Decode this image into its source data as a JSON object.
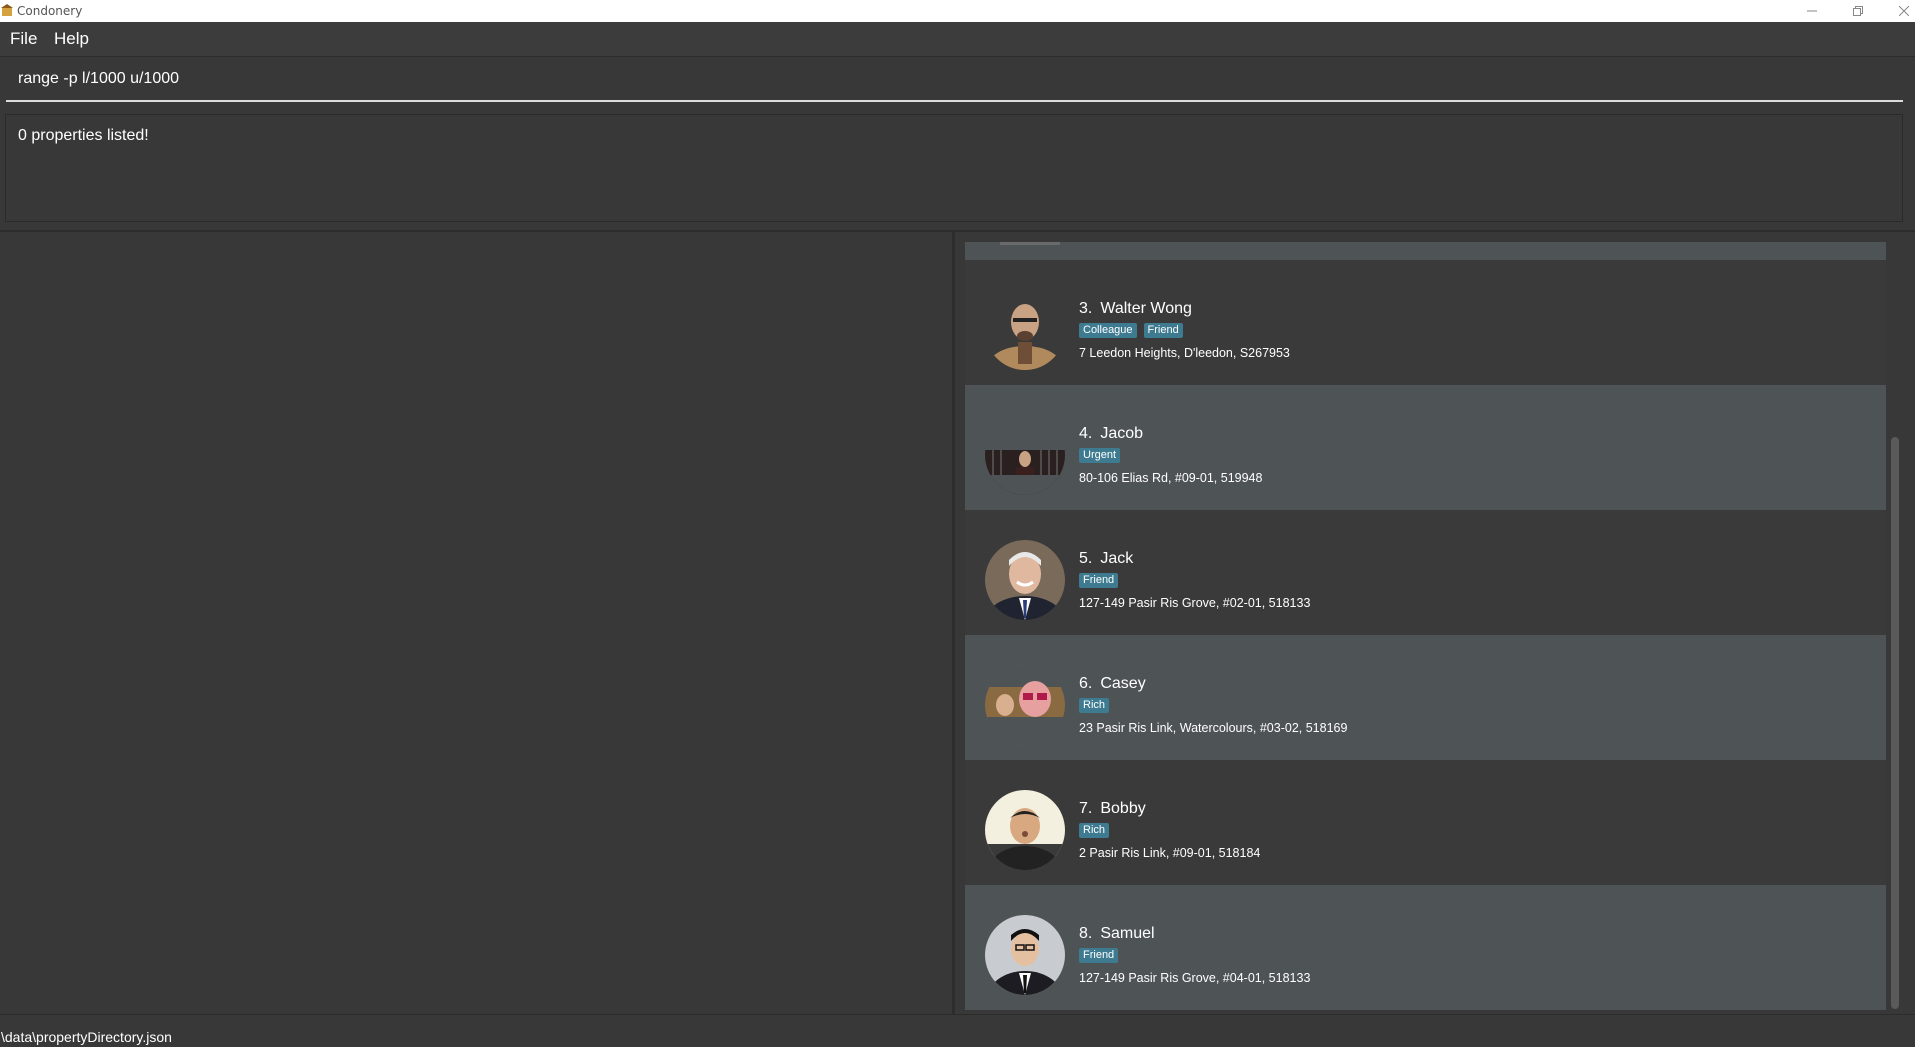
{
  "window": {
    "title": "Condonery",
    "controls": [
      "minimize-icon",
      "restore-icon",
      "close-icon"
    ]
  },
  "menu": {
    "file": "File",
    "help": "Help"
  },
  "command": {
    "value": "range -p l/1000 u/1000"
  },
  "result": {
    "message": "0 properties listed!"
  },
  "property_list": {
    "items": [
      {
        "index": "3.",
        "name": "Walter Wong",
        "tags": [
          "Colleague",
          "Friend"
        ],
        "address": "7 Leedon Heights, D'leedon, S267953"
      },
      {
        "index": "4.",
        "name": "Jacob",
        "tags": [
          "Urgent"
        ],
        "address": "80-106 Elias Rd, #09-01, 519948"
      },
      {
        "index": "5.",
        "name": "Jack",
        "tags": [
          "Friend"
        ],
        "address": "127-149 Pasir Ris Grove, #02-01, 518133"
      },
      {
        "index": "6.",
        "name": "Casey",
        "tags": [
          "Rich"
        ],
        "address": "23 Pasir Ris Link, Watercolours, #03-02, 518169"
      },
      {
        "index": "7.",
        "name": "Bobby",
        "tags": [
          "Rich"
        ],
        "address": "2 Pasir Ris Link, #09-01, 518184"
      },
      {
        "index": "8.",
        "name": "Samuel",
        "tags": [
          "Friend"
        ],
        "address": "127-149 Pasir Ris Grove, #04-01, 518133"
      }
    ]
  },
  "status": {
    "path": "\\data\\propertyDirectory.json"
  },
  "colors": {
    "background": "#383838",
    "card_alt": "#4e5356",
    "tag": "#3e7b91"
  }
}
